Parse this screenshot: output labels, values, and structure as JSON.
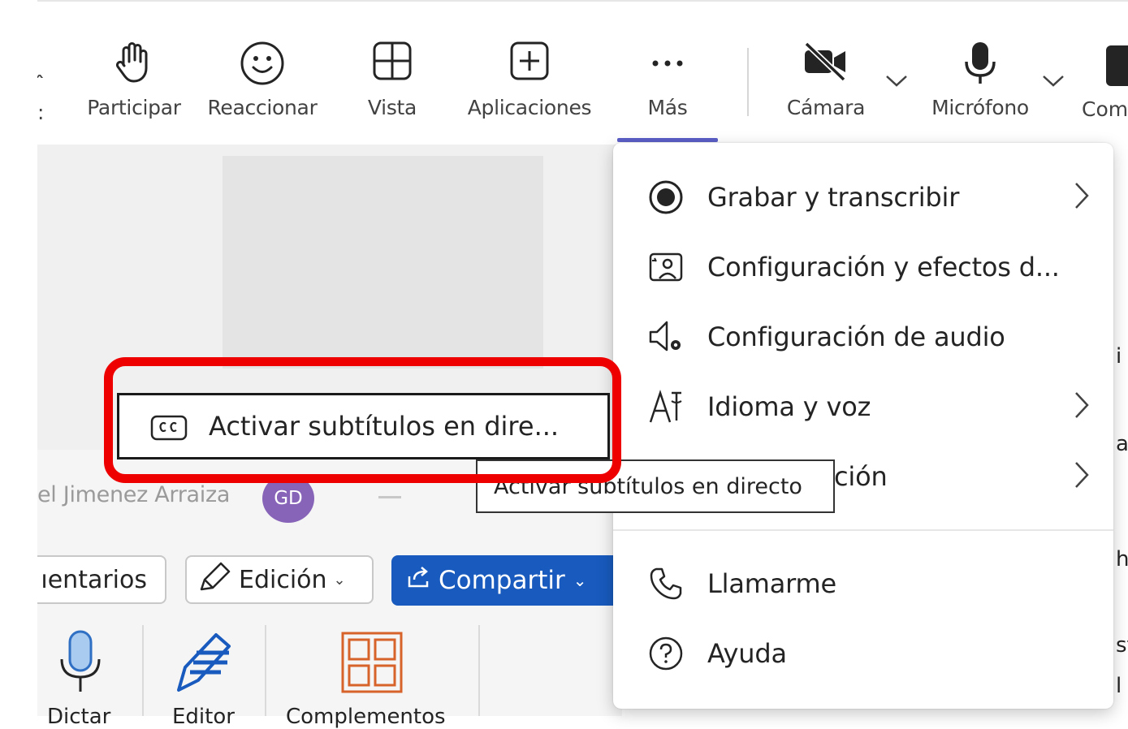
{
  "toolbar": {
    "items": [
      {
        "label": "Participar",
        "icon": "raise-hand-icon"
      },
      {
        "label": "Reaccionar",
        "icon": "smiley-icon"
      },
      {
        "label": "Vista",
        "icon": "grid-view-icon"
      },
      {
        "label": "Aplicaciones",
        "icon": "add-app-icon"
      },
      {
        "label": "Más",
        "icon": "more-dots-icon"
      },
      {
        "label": "Cámara",
        "icon": "camera-off-icon"
      },
      {
        "label": "Micrófono",
        "icon": "microphone-icon"
      },
      {
        "label": "Com",
        "icon": "share-icon"
      }
    ],
    "active_color": "#5b5fc7"
  },
  "more_menu": {
    "items": [
      {
        "label": "Grabar y transcribir",
        "icon": "record-icon",
        "has_submenu": true
      },
      {
        "label": "Configuración y efectos d...",
        "icon": "background-effects-icon",
        "has_submenu": false
      },
      {
        "label": "Configuración de audio",
        "icon": "speaker-settings-icon",
        "has_submenu": false
      },
      {
        "label": "Idioma y voz",
        "icon": "language-icon",
        "has_submenu": true
      },
      {
        "label": "ción",
        "icon": "accessibility-icon",
        "has_submenu": true
      },
      {
        "label": "Llamarme",
        "icon": "phone-icon",
        "has_submenu": false
      },
      {
        "label": "Ayuda",
        "icon": "help-icon",
        "has_submenu": false
      }
    ]
  },
  "submenu": {
    "item_label": "Activar subtítulos en dire...",
    "tooltip": "Activar subtítulos en directo",
    "icon": "closed-captions-icon",
    "highlight_color": "#ee0000"
  },
  "participant": {
    "name": "el Jimenez Arraiza",
    "initials": "GD",
    "avatar_color": "#8764b8"
  },
  "word_ribbon": {
    "comentarios": "ıentarios",
    "edicion": "Edición",
    "compartir": "Compartir",
    "compartir_color": "#185abd",
    "tools": [
      {
        "label": "Dictar",
        "icon": "dictate-mic-icon"
      },
      {
        "label": "Editor",
        "icon": "editor-pen-icon"
      },
      {
        "label": "Complementos",
        "icon": "add-ins-grid-icon"
      }
    ]
  },
  "right_peek": [
    "i",
    "a",
    "hi",
    "st",
    "l"
  ]
}
